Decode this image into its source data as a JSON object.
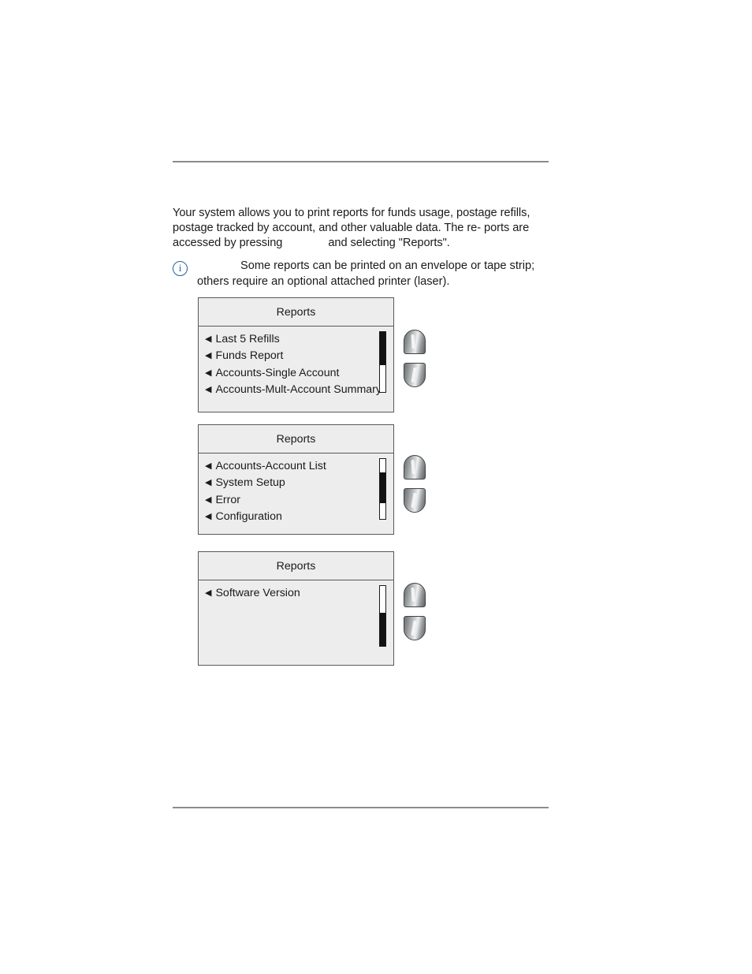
{
  "intro": {
    "line_1": "Your system allows you to print reports for funds usage, postage",
    "line_2": "refills, postage tracked by account, and other valuable data. The re-",
    "line_3_a": "ports are accessed by pressing",
    "line_3_b": "and selecting \"Reports\"."
  },
  "note": {
    "icon": "info-icon",
    "icon_glyph": "i",
    "line_1": "Some reports can be printed on an envelope or tape strip;",
    "line_2": "others require an optional attached printer (laser)."
  },
  "panels": [
    {
      "title": "Reports",
      "items": [
        "Last 5 Refills",
        "Funds Report",
        "Accounts-Single Account",
        "Accounts-Mult-Account Summary"
      ],
      "arrow_glyph": "◀",
      "scroll": {
        "thumb_top_pct": 0,
        "thumb_height_pct": 55
      },
      "buttons": [
        {
          "name": "scroll-up-button",
          "label": "Up"
        },
        {
          "name": "scroll-down-button",
          "label": "Down"
        }
      ]
    },
    {
      "title": "Reports",
      "items": [
        "Accounts-Account List",
        "System Setup",
        "Error",
        "Configuration"
      ],
      "arrow_glyph": "◀",
      "scroll": {
        "thumb_top_pct": 22,
        "thumb_height_pct": 52
      },
      "buttons": [
        {
          "name": "scroll-up-button",
          "label": "Up"
        },
        {
          "name": "scroll-down-button",
          "label": "Down"
        }
      ]
    },
    {
      "title": "Reports",
      "items": [
        "Software Version"
      ],
      "arrow_glyph": "◀",
      "scroll": {
        "thumb_top_pct": 45,
        "thumb_height_pct": 55
      },
      "buttons": [
        {
          "name": "scroll-up-button",
          "label": "Up"
        },
        {
          "name": "scroll-down-button",
          "label": "Down"
        }
      ]
    }
  ],
  "colors": {
    "rule": "#8c8c8c",
    "panel_border": "#58585a",
    "panel_fill": "#ededed",
    "note_icon": "#1f5fa0",
    "scroll_thumb": "#121212"
  }
}
